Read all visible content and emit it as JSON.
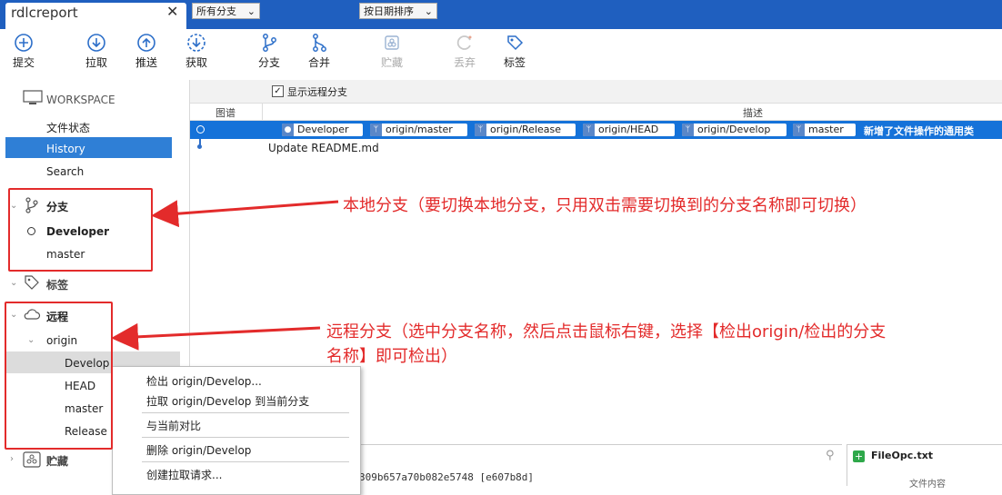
{
  "window": {
    "tab_title": "rdlcreport",
    "close_glyph": "✕",
    "new_tab_glyph": "+",
    "tab_menu_glyph": "▼"
  },
  "toolbar": {
    "commit": "提交",
    "pull": "拉取",
    "push": "推送",
    "fetch": "获取",
    "branch": "分支",
    "merge": "合并",
    "stash": "贮藏",
    "discard": "丢弃",
    "tag": "标签"
  },
  "sidebar": {
    "workspace": "WORKSPACE",
    "file_status": "文件状态",
    "history": "History",
    "search": "Search",
    "branches_header": "分支",
    "branches": [
      "Developer",
      "master"
    ],
    "tags_header": "标签",
    "remotes_header": "远程",
    "remote_origin": "origin",
    "remote_branches": [
      "Develop",
      "HEAD",
      "master",
      "Release"
    ],
    "stashes_header": "贮藏"
  },
  "filter": {
    "all_branches": "所有分支",
    "show_remote": "显示远程分支",
    "sort": "按日期排序"
  },
  "table": {
    "col_graph": "图谱",
    "col_desc": "描述",
    "rows": [
      {
        "tags": [
          "Developer",
          "origin/master",
          "origin/Release",
          "origin/HEAD",
          "origin/Develop",
          "master"
        ],
        "message": "新增了文件操作的通用类"
      },
      {
        "tags": [],
        "message": "Update README.md"
      }
    ]
  },
  "annotations": {
    "local_branch_note": "本地分支（要切换本地分支，只用双击需要切换到的分支名称即可切换）",
    "remote_branch_note_line1": "远程分支（选中分支名称，然后点击鼠标右键，选择【检出origin/检出的分支",
    "remote_branch_note_line2": "名称】即可检出）",
    "color": "#e32b2b"
  },
  "context_menu": {
    "items": [
      "检出 origin/Develop...",
      "拉取 origin/Develop 到当前分支",
      "与当前对比",
      "删除 origin/Develop",
      "创建拉取请求..."
    ]
  },
  "bottom": {
    "commit_hash": "309b657a70b082e5748 [e607b8d]",
    "file_name": "FileOpc.txt",
    "file_content_label": "文件内容"
  },
  "colors": {
    "titlebar": "#1f5fbf",
    "selection": "#1572d9",
    "history_selected": "#2f7fd6"
  }
}
